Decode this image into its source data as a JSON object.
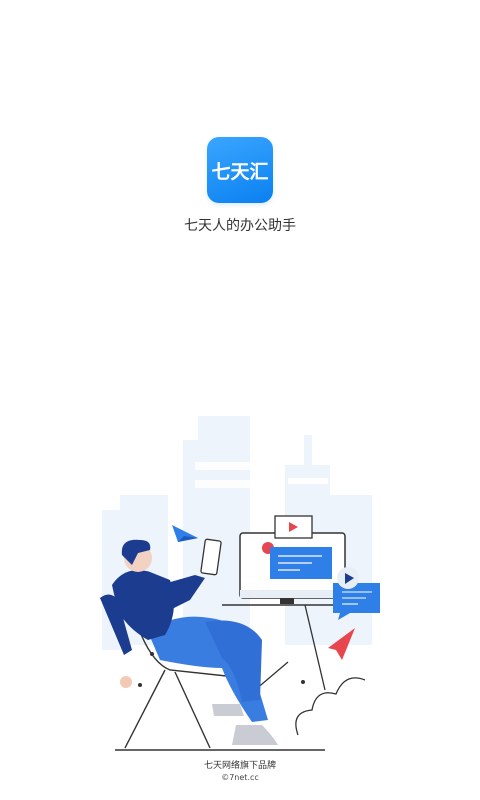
{
  "app": {
    "logo_text": "七天汇",
    "tagline": "七天人的办公助手"
  },
  "footer": {
    "brand": "七天网络旗下品牌",
    "site": "©7net.cc"
  },
  "colors": {
    "brand_blue": "#1e88ff",
    "navy": "#1b3c8f",
    "light_building": "#eef4fb",
    "red_accent": "#e8464e"
  }
}
